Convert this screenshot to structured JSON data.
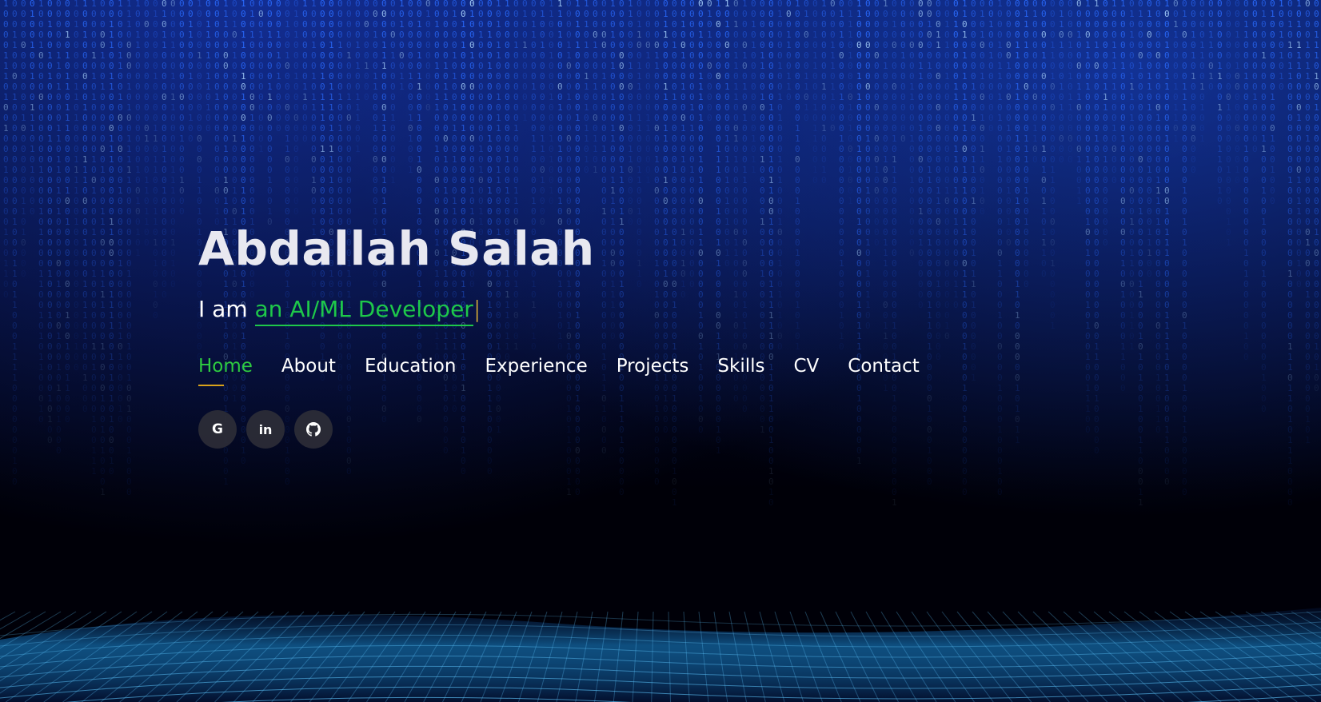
{
  "hero": {
    "name": "Abdallah Salah",
    "intro": "I am ",
    "role": "an AI/ML Developer",
    "cursor": "|"
  },
  "nav": {
    "items": [
      {
        "label": "Home",
        "active": true
      },
      {
        "label": "About"
      },
      {
        "label": "Education"
      },
      {
        "label": "Experience"
      },
      {
        "label": "Projects"
      },
      {
        "label": "Skills"
      },
      {
        "label": "CV"
      },
      {
        "label": "Contact"
      }
    ]
  },
  "social": {
    "items": [
      {
        "icon": "google-icon",
        "glyph": "G"
      },
      {
        "icon": "linkedin-icon",
        "glyph": "in"
      },
      {
        "icon": "github-icon"
      }
    ]
  },
  "colors": {
    "accent_green": "#2ecc40",
    "underline_gold": "#d9a21b",
    "rain_blue": "#2a6bff",
    "background": "#000010"
  }
}
